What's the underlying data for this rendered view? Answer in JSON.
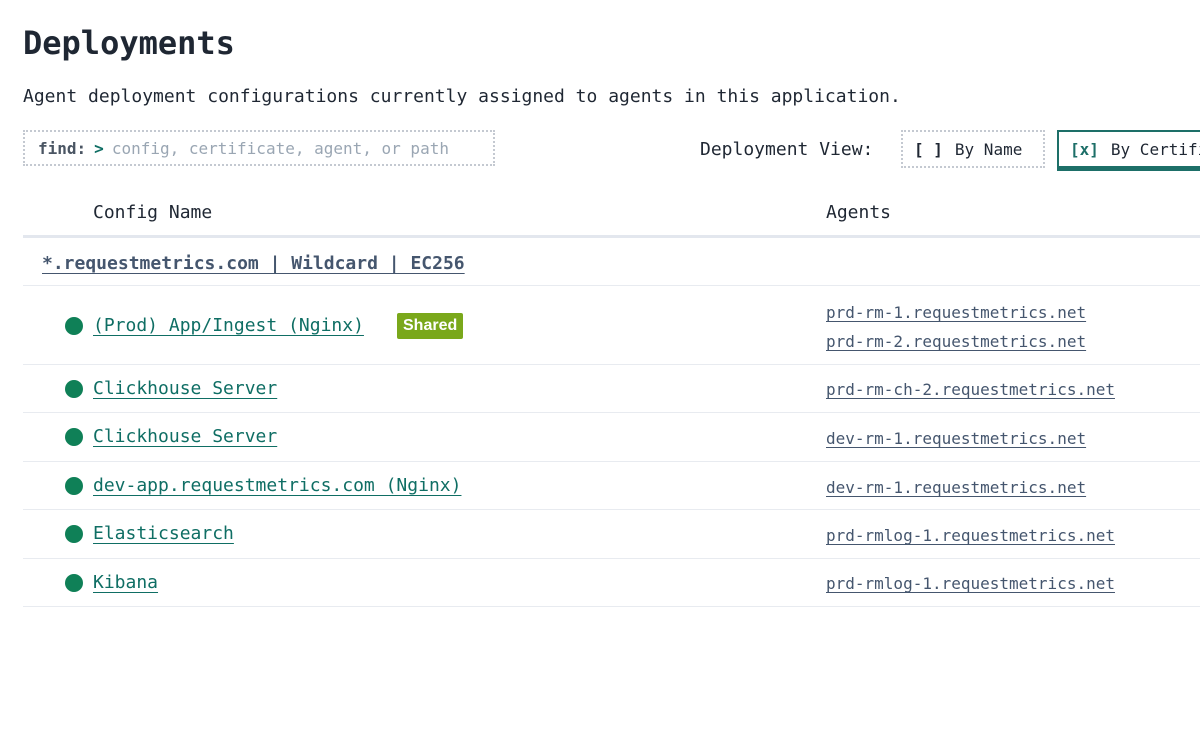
{
  "page": {
    "title": "Deployments",
    "subtitle": "Agent deployment configurations currently assigned to agents in this application."
  },
  "search": {
    "label": "find:",
    "prompt": ">",
    "placeholder": "config, certificate, agent, or path",
    "value": ""
  },
  "view": {
    "label": "Deployment View:",
    "options": [
      {
        "mark": "[ ]",
        "label": "By Name",
        "selected": false
      },
      {
        "mark": "[x]",
        "label": "By Certificate",
        "selected": true
      }
    ]
  },
  "table": {
    "headers": {
      "config": "Config Name",
      "agents": "Agents"
    },
    "group": "*.requestmetrics.com | Wildcard | EC256",
    "rows": [
      {
        "config": "(Prod) App/Ingest (Nginx)",
        "badge": "Shared",
        "status": "online",
        "agents": [
          "prd-rm-1.requestmetrics.net",
          "prd-rm-2.requestmetrics.net"
        ]
      },
      {
        "config": "Clickhouse Server",
        "status": "online",
        "agents": [
          "prd-rm-ch-2.requestmetrics.net"
        ]
      },
      {
        "config": "Clickhouse Server",
        "status": "online",
        "agents": [
          "dev-rm-1.requestmetrics.net"
        ]
      },
      {
        "config": "dev-app.requestmetrics.com (Nginx)",
        "status": "online",
        "agents": [
          "dev-rm-1.requestmetrics.net"
        ]
      },
      {
        "config": "Elasticsearch",
        "status": "online",
        "agents": [
          "prd-rmlog-1.requestmetrics.net"
        ]
      },
      {
        "config": "Kibana",
        "status": "online",
        "agents": [
          "prd-rmlog-1.requestmetrics.net"
        ]
      }
    ]
  },
  "colors": {
    "status_online": "#0f8057",
    "accent": "#0f6e64",
    "badge_shared": "#7aa81b",
    "agent_link": "#45566e"
  }
}
